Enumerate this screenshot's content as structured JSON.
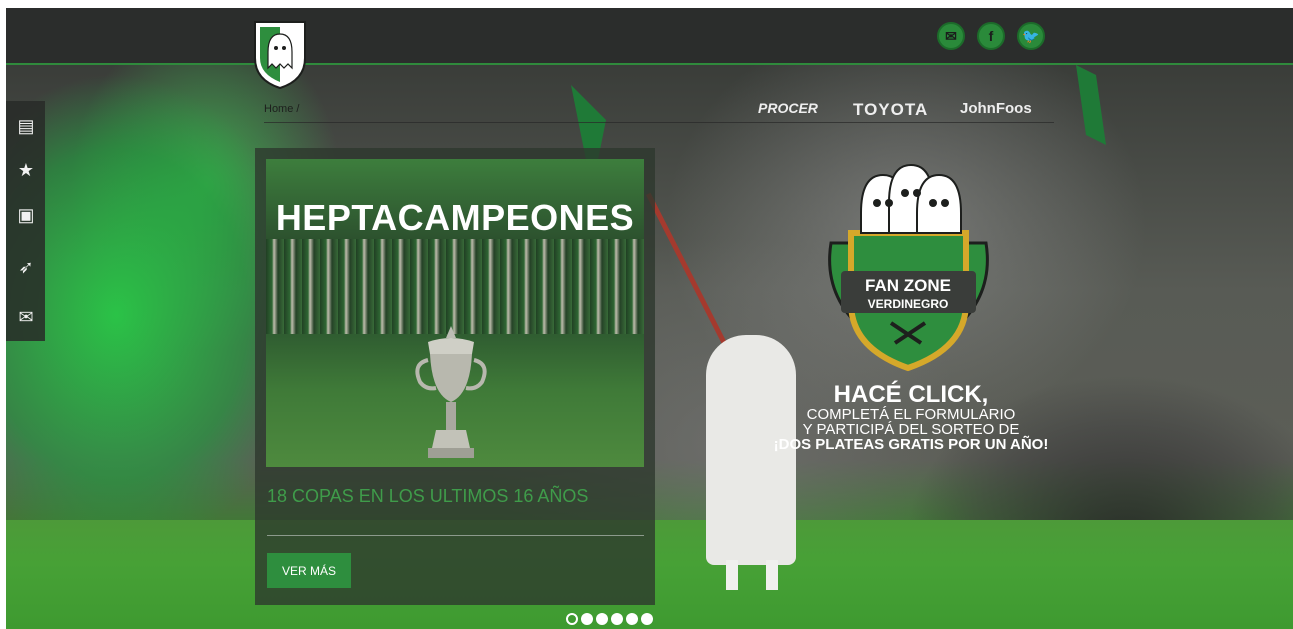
{
  "header": {
    "social": [
      {
        "name": "email",
        "glyph": "✉"
      },
      {
        "name": "facebook",
        "glyph": "f"
      },
      {
        "name": "twitter",
        "glyph": "🐦"
      }
    ]
  },
  "sidebar": {
    "items": [
      {
        "name": "news-icon",
        "glyph": "▤"
      },
      {
        "name": "star-icon",
        "glyph": "★"
      },
      {
        "name": "id-card-icon",
        "glyph": "▣"
      },
      {
        "name": "hockey-icon",
        "glyph": "➶"
      },
      {
        "name": "mail-icon",
        "glyph": "✉"
      }
    ]
  },
  "breadcrumb": {
    "home": "Home",
    "separator": "/"
  },
  "sponsors": [
    "PROCER",
    "TOYOTA",
    "JohnFoos"
  ],
  "card": {
    "image_title": "HEPTACAMPEONES",
    "caption": "18 COPAS EN LOS ULTIMOS 16 AÑOS",
    "button_label": "VER MÁS"
  },
  "promo": {
    "badge_line1": "FAN ZONE",
    "badge_line2": "VERDINEGRO",
    "line1": "HACÉ CLICK,",
    "line2": "COMPLETÁ EL FORMULARIO",
    "line3": "Y PARTICIPÁ DEL SORTEO DE",
    "line4": "¡DOS PLATEAS GRATIS POR UN AÑO!"
  },
  "carousel": {
    "slides": 6,
    "active_index": 0
  },
  "colors": {
    "brand_green": "#2e8e3e",
    "topbar": "#2b2d2c"
  }
}
